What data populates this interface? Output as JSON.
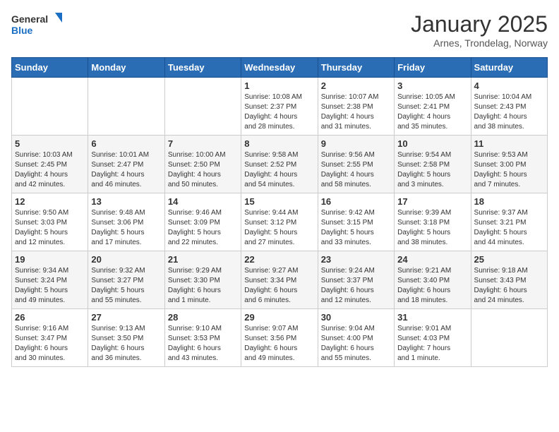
{
  "header": {
    "logo_line1": "General",
    "logo_line2": "Blue",
    "month_title": "January 2025",
    "location": "Arnes, Trondelag, Norway"
  },
  "weekdays": [
    "Sunday",
    "Monday",
    "Tuesday",
    "Wednesday",
    "Thursday",
    "Friday",
    "Saturday"
  ],
  "weeks": [
    [
      {
        "day": "",
        "info": ""
      },
      {
        "day": "",
        "info": ""
      },
      {
        "day": "",
        "info": ""
      },
      {
        "day": "1",
        "info": "Sunrise: 10:08 AM\nSunset: 2:37 PM\nDaylight: 4 hours\nand 28 minutes."
      },
      {
        "day": "2",
        "info": "Sunrise: 10:07 AM\nSunset: 2:38 PM\nDaylight: 4 hours\nand 31 minutes."
      },
      {
        "day": "3",
        "info": "Sunrise: 10:05 AM\nSunset: 2:41 PM\nDaylight: 4 hours\nand 35 minutes."
      },
      {
        "day": "4",
        "info": "Sunrise: 10:04 AM\nSunset: 2:43 PM\nDaylight: 4 hours\nand 38 minutes."
      }
    ],
    [
      {
        "day": "5",
        "info": "Sunrise: 10:03 AM\nSunset: 2:45 PM\nDaylight: 4 hours\nand 42 minutes."
      },
      {
        "day": "6",
        "info": "Sunrise: 10:01 AM\nSunset: 2:47 PM\nDaylight: 4 hours\nand 46 minutes."
      },
      {
        "day": "7",
        "info": "Sunrise: 10:00 AM\nSunset: 2:50 PM\nDaylight: 4 hours\nand 50 minutes."
      },
      {
        "day": "8",
        "info": "Sunrise: 9:58 AM\nSunset: 2:52 PM\nDaylight: 4 hours\nand 54 minutes."
      },
      {
        "day": "9",
        "info": "Sunrise: 9:56 AM\nSunset: 2:55 PM\nDaylight: 4 hours\nand 58 minutes."
      },
      {
        "day": "10",
        "info": "Sunrise: 9:54 AM\nSunset: 2:58 PM\nDaylight: 5 hours\nand 3 minutes."
      },
      {
        "day": "11",
        "info": "Sunrise: 9:53 AM\nSunset: 3:00 PM\nDaylight: 5 hours\nand 7 minutes."
      }
    ],
    [
      {
        "day": "12",
        "info": "Sunrise: 9:50 AM\nSunset: 3:03 PM\nDaylight: 5 hours\nand 12 minutes."
      },
      {
        "day": "13",
        "info": "Sunrise: 9:48 AM\nSunset: 3:06 PM\nDaylight: 5 hours\nand 17 minutes."
      },
      {
        "day": "14",
        "info": "Sunrise: 9:46 AM\nSunset: 3:09 PM\nDaylight: 5 hours\nand 22 minutes."
      },
      {
        "day": "15",
        "info": "Sunrise: 9:44 AM\nSunset: 3:12 PM\nDaylight: 5 hours\nand 27 minutes."
      },
      {
        "day": "16",
        "info": "Sunrise: 9:42 AM\nSunset: 3:15 PM\nDaylight: 5 hours\nand 33 minutes."
      },
      {
        "day": "17",
        "info": "Sunrise: 9:39 AM\nSunset: 3:18 PM\nDaylight: 5 hours\nand 38 minutes."
      },
      {
        "day": "18",
        "info": "Sunrise: 9:37 AM\nSunset: 3:21 PM\nDaylight: 5 hours\nand 44 minutes."
      }
    ],
    [
      {
        "day": "19",
        "info": "Sunrise: 9:34 AM\nSunset: 3:24 PM\nDaylight: 5 hours\nand 49 minutes."
      },
      {
        "day": "20",
        "info": "Sunrise: 9:32 AM\nSunset: 3:27 PM\nDaylight: 5 hours\nand 55 minutes."
      },
      {
        "day": "21",
        "info": "Sunrise: 9:29 AM\nSunset: 3:30 PM\nDaylight: 6 hours\nand 1 minute."
      },
      {
        "day": "22",
        "info": "Sunrise: 9:27 AM\nSunset: 3:34 PM\nDaylight: 6 hours\nand 6 minutes."
      },
      {
        "day": "23",
        "info": "Sunrise: 9:24 AM\nSunset: 3:37 PM\nDaylight: 6 hours\nand 12 minutes."
      },
      {
        "day": "24",
        "info": "Sunrise: 9:21 AM\nSunset: 3:40 PM\nDaylight: 6 hours\nand 18 minutes."
      },
      {
        "day": "25",
        "info": "Sunrise: 9:18 AM\nSunset: 3:43 PM\nDaylight: 6 hours\nand 24 minutes."
      }
    ],
    [
      {
        "day": "26",
        "info": "Sunrise: 9:16 AM\nSunset: 3:47 PM\nDaylight: 6 hours\nand 30 minutes."
      },
      {
        "day": "27",
        "info": "Sunrise: 9:13 AM\nSunset: 3:50 PM\nDaylight: 6 hours\nand 36 minutes."
      },
      {
        "day": "28",
        "info": "Sunrise: 9:10 AM\nSunset: 3:53 PM\nDaylight: 6 hours\nand 43 minutes."
      },
      {
        "day": "29",
        "info": "Sunrise: 9:07 AM\nSunset: 3:56 PM\nDaylight: 6 hours\nand 49 minutes."
      },
      {
        "day": "30",
        "info": "Sunrise: 9:04 AM\nSunset: 4:00 PM\nDaylight: 6 hours\nand 55 minutes."
      },
      {
        "day": "31",
        "info": "Sunrise: 9:01 AM\nSunset: 4:03 PM\nDaylight: 7 hours\nand 1 minute."
      },
      {
        "day": "",
        "info": ""
      }
    ]
  ]
}
